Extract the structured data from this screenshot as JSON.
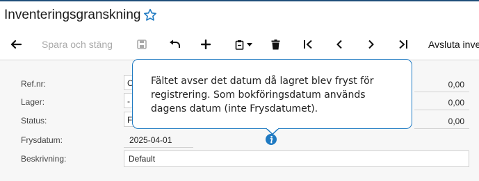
{
  "window": {
    "title": "Inventeringsgranskning"
  },
  "toolbar": {
    "save_close_label": "Spara och stäng",
    "finish_label": "Avsluta inve"
  },
  "form": {
    "ref_label": "Ref.nr:",
    "ref_value": "C",
    "warehouse_label": "Lager:",
    "warehouse_value": "-",
    "status_label": "Status:",
    "status_value": "F",
    "freeze_label": "Frysdatum:",
    "freeze_value": "2025-04-01",
    "desc_label": "Beskrivning:",
    "desc_value": "Default",
    "totals": [
      "0,00",
      "0,00",
      "0,00"
    ]
  },
  "tooltip": {
    "text": "Fältet avser det datum då lagret blev fryst för registrering. Som bokföringsdatum används dagens datum (inte Frysdatumet)."
  },
  "colors": {
    "accent": "#1f7ac2",
    "top_border": "#1f4e79",
    "disabled_text": "#a9a9a9"
  },
  "icons": [
    "star-icon",
    "back-arrow-icon",
    "save-icon",
    "undo-icon",
    "add-icon",
    "clipboard-icon",
    "chevron-down-icon",
    "delete-icon",
    "first-page-icon",
    "previous-icon",
    "next-icon",
    "last-page-icon",
    "info-icon"
  ]
}
